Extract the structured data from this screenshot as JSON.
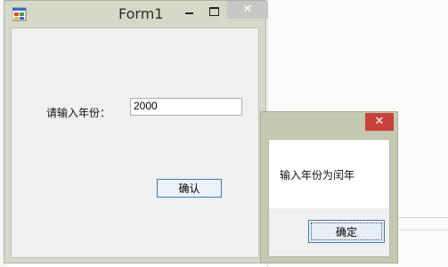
{
  "form": {
    "title": "Form1",
    "icon": "windows-forms-app-icon",
    "minimize_icon": "minimize-icon",
    "maximize_icon": "maximize-icon",
    "close_symbol": "✕",
    "year_label": "请输入年份：",
    "year_value": "2000",
    "confirm_label": "确认"
  },
  "message_box": {
    "close_symbol": "✕",
    "message": "输入年份为闰年",
    "ok_label": "确定",
    "colors": {
      "close_button": "#c8413a",
      "frame": "#c5c9b2"
    }
  }
}
